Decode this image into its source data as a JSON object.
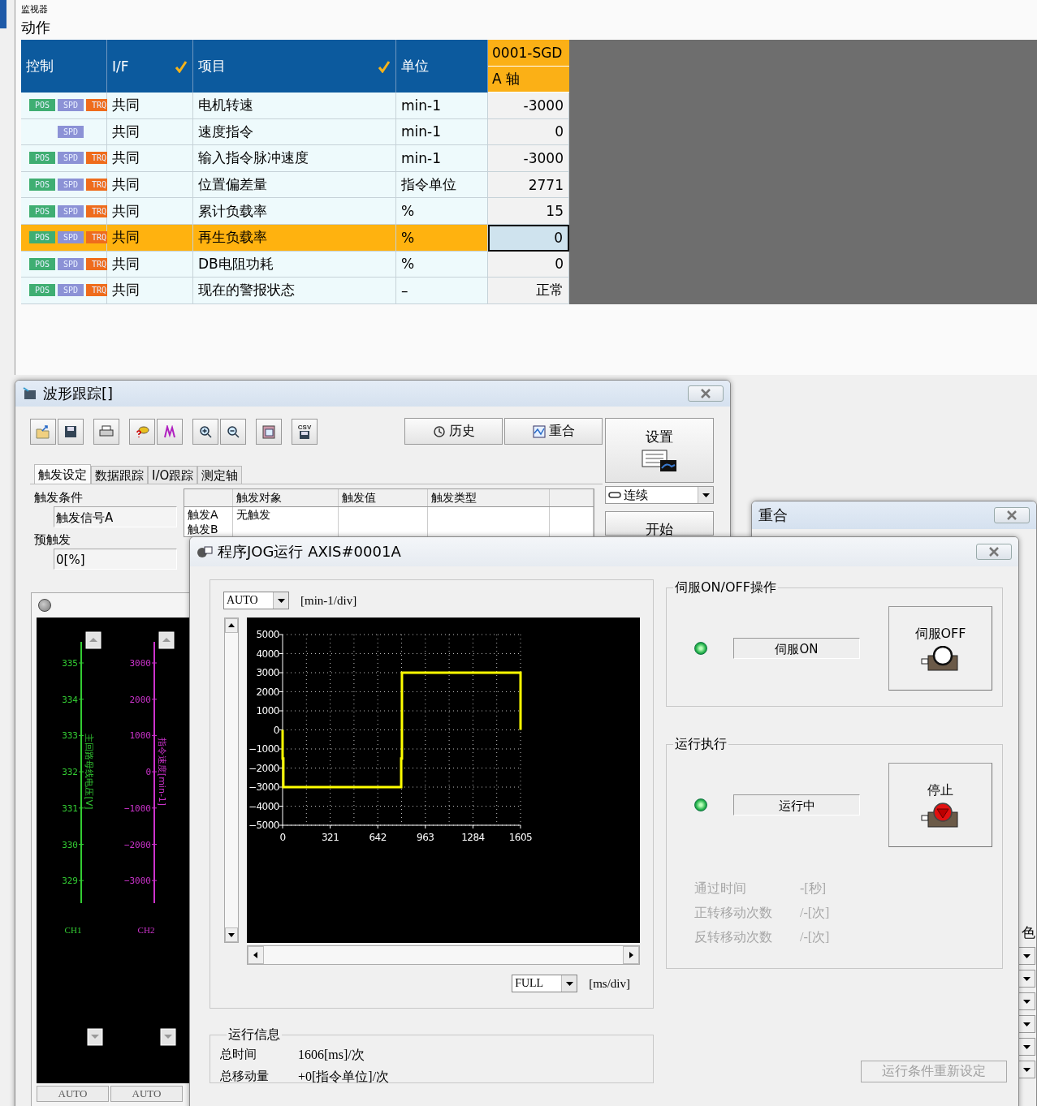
{
  "monitor": {
    "title": "监视器",
    "section": "动作",
    "columns": [
      {
        "label": "控制",
        "checked": false
      },
      {
        "label": "I/F",
        "checked": true
      },
      {
        "label": "项目",
        "checked": true
      },
      {
        "label": "单位",
        "checked": false
      }
    ],
    "axis_header": {
      "device": "0001-SGD",
      "axis": "A 轴"
    },
    "rows": [
      {
        "modes": [
          {
            "kind": "pos",
            "label": "POS",
            "color": "#3fae72"
          },
          {
            "kind": "spd",
            "label": "SPD",
            "color": "#8c92d6"
          },
          {
            "kind": "trq",
            "label": "TRQ",
            "color": "#ef6c1c"
          }
        ],
        "interface": "共同",
        "item": "电机转速",
        "unit": "min-1",
        "value": "-3000",
        "selected": false
      },
      {
        "modes": [
          {
            "kind": "spd",
            "label": "SPD",
            "color": "#8c92d6"
          }
        ],
        "interface": "共同",
        "item": "速度指令",
        "unit": "min-1",
        "value": "0",
        "selected": false
      },
      {
        "modes": [
          {
            "kind": "pos",
            "label": "POS",
            "color": "#3fae72"
          },
          {
            "kind": "spd",
            "label": "SPD",
            "color": "#8c92d6"
          },
          {
            "kind": "trq",
            "label": "TRQ",
            "color": "#ef6c1c"
          }
        ],
        "interface": "共同",
        "item": "输入指令脉冲速度",
        "unit": "min-1",
        "value": "-3000",
        "selected": false
      },
      {
        "modes": [
          {
            "kind": "pos",
            "label": "POS",
            "color": "#3fae72"
          },
          {
            "kind": "spd",
            "label": "SPD",
            "color": "#8c92d6"
          },
          {
            "kind": "trq",
            "label": "TRQ",
            "color": "#ef6c1c"
          }
        ],
        "interface": "共同",
        "item": "位置偏差量",
        "unit": "指令单位",
        "value": "2771",
        "selected": false
      },
      {
        "modes": [
          {
            "kind": "pos",
            "label": "POS",
            "color": "#3fae72"
          },
          {
            "kind": "spd",
            "label": "SPD",
            "color": "#8c92d6"
          },
          {
            "kind": "trq",
            "label": "TRQ",
            "color": "#ef6c1c"
          }
        ],
        "interface": "共同",
        "item": "累计负载率",
        "unit": "%",
        "value": "15",
        "selected": false
      },
      {
        "modes": [
          {
            "kind": "pos",
            "label": "POS",
            "color": "#3fae72"
          },
          {
            "kind": "spd",
            "label": "SPD",
            "color": "#8c92d6"
          },
          {
            "kind": "trq",
            "label": "TRQ",
            "color": "#ef6c1c"
          }
        ],
        "interface": "共同",
        "item": "再生负载率",
        "unit": "%",
        "value": "0",
        "selected": true
      },
      {
        "modes": [
          {
            "kind": "pos",
            "label": "POS",
            "color": "#3fae72"
          },
          {
            "kind": "spd",
            "label": "SPD",
            "color": "#8c92d6"
          },
          {
            "kind": "trq",
            "label": "TRQ",
            "color": "#ef6c1c"
          }
        ],
        "interface": "共同",
        "item": "DB电阻功耗",
        "unit": "%",
        "value": "0",
        "selected": false
      },
      {
        "modes": [
          {
            "kind": "pos",
            "label": "POS",
            "color": "#3fae72"
          },
          {
            "kind": "spd",
            "label": "SPD",
            "color": "#8c92d6"
          },
          {
            "kind": "trq",
            "label": "TRQ",
            "color": "#ef6c1c"
          }
        ],
        "interface": "共同",
        "item": "现在的警报状态",
        "unit": "–",
        "value": "正常",
        "selected": false
      }
    ]
  },
  "waveform_window": {
    "title": "波形跟踪[]",
    "toolbar": [
      {
        "kind": "open"
      },
      {
        "kind": "save"
      },
      {
        "kind": "print"
      },
      {
        "kind": "marker"
      },
      {
        "kind": "cursor"
      },
      {
        "kind": "zoom-in"
      },
      {
        "kind": "zoom-out"
      },
      {
        "kind": "clipboard"
      },
      {
        "kind": "csv",
        "label": "CSV"
      }
    ],
    "buttons": [
      {
        "kind": "history",
        "label": "历史"
      },
      {
        "kind": "overlay",
        "label": "重合"
      }
    ],
    "settings_button": "设置",
    "mode_select": "连续",
    "start_button": "开始",
    "tabs": [
      {
        "label": "触发设定",
        "selected": true
      },
      {
        "label": "数据跟踪",
        "selected": false
      },
      {
        "label": "I/O跟踪",
        "selected": false
      },
      {
        "label": "测定轴",
        "selected": false
      }
    ],
    "trigger_condition": {
      "label": "触发条件",
      "value": "触发信号A"
    },
    "pre_trigger": {
      "label": "预触发",
      "value": "0[%]"
    },
    "trigger_table": {
      "columns": [
        "触发对象",
        "触发值",
        "触发类型"
      ],
      "rows": [
        {
          "name": "触发A",
          "target": "无触发"
        },
        {
          "name": "触发B"
        }
      ]
    },
    "status_led": {
      "on": false
    },
    "channels": [
      {
        "name": "CH1",
        "axis_label": "主回路母线电压[V]",
        "color": "#33cc33",
        "ticks": [
          "335",
          "334",
          "333",
          "332",
          "331",
          "330",
          "329"
        ],
        "scale": "AUTO"
      },
      {
        "name": "CH2",
        "axis_label": "指令速度[min-1]",
        "color": "#cc33cc",
        "ticks": [
          "3000",
          "2000",
          "1000",
          "0",
          "−1000",
          "−2000",
          "−3000"
        ],
        "scale": "AUTO"
      }
    ]
  },
  "overlay_window": {
    "title": "重合",
    "column_label": "色"
  },
  "jog_window": {
    "title": "程序JOG运行 AXIS#0001A",
    "y_scale": {
      "value": "AUTO",
      "unit": "[min-1/div]"
    },
    "x_scale": {
      "value": "FULL",
      "unit": "[ms/div]"
    },
    "chart_data": {
      "type": "line",
      "x": [
        0,
        0,
        5,
        5,
        800,
        800,
        805,
        805,
        1605,
        1605
      ],
      "series": [
        {
          "color": "#ffff00",
          "values": [
            0,
            -1500,
            -1500,
            -3000,
            -3000,
            -1500,
            -1500,
            3000,
            3000,
            0
          ]
        }
      ],
      "grid": true,
      "xlim": [
        0,
        1605
      ],
      "ylim": [
        -5000,
        5000
      ],
      "xticks": [
        0,
        321,
        642,
        963,
        1284,
        1605
      ],
      "yticks": [
        5000,
        4000,
        3000,
        2000,
        1000,
        0,
        {
          "value": -1000,
          "label": "−1000"
        },
        {
          "value": -2000,
          "label": "−2000"
        },
        {
          "value": -3000,
          "label": "−3000"
        },
        {
          "value": -4000,
          "label": "−4000"
        },
        {
          "value": -5000,
          "label": "−5000"
        }
      ]
    },
    "run_info": {
      "title": "运行信息",
      "rows": [
        {
          "label": "总时间",
          "value": "1606[ms]/次"
        },
        {
          "label": "总移动量",
          "value": "+0[指令单位]/次"
        }
      ]
    },
    "servo_group": {
      "title": "伺服ON/OFF操作",
      "led_on": true,
      "status": "伺服ON",
      "button": "伺服OFF"
    },
    "run_group": {
      "title": "运行执行",
      "led_on": true,
      "status": "运行中",
      "button": "停止",
      "stats": [
        {
          "label": "通过时间",
          "value": "-[秒]",
          "disabled": true
        },
        {
          "label": "正转移动次数",
          "value": "/-[次]",
          "disabled": true
        },
        {
          "label": "反转移动次数",
          "value": "/-[次]",
          "disabled": true
        }
      ]
    },
    "reset_button": {
      "label": "运行条件重新设定",
      "disabled": true
    }
  }
}
